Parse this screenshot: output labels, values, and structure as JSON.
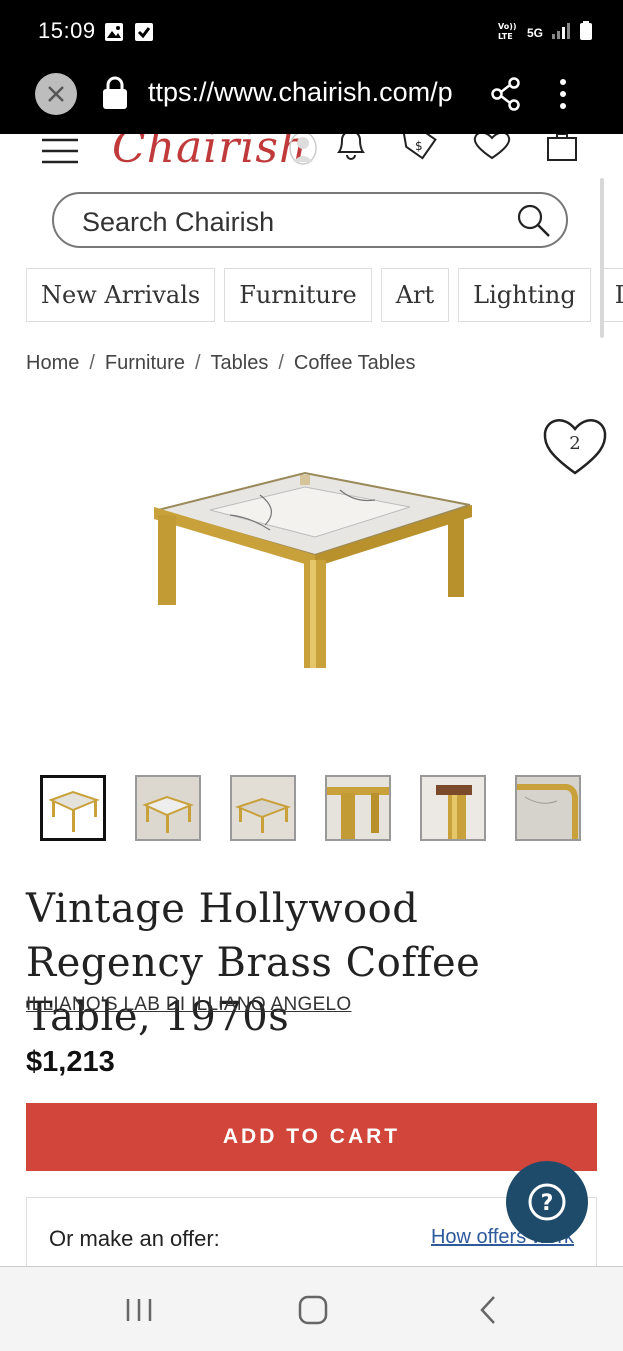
{
  "status_bar": {
    "time": "15:09",
    "network": "5G"
  },
  "browser": {
    "url": "ttps://www.chairish.com/p"
  },
  "site": {
    "logo": "Chairish",
    "search_placeholder": "Search Chairish",
    "categories": [
      "New Arrivals",
      "Furniture",
      "Art",
      "Lighting",
      "Dec"
    ],
    "breadcrumbs": [
      "Home",
      "Furniture",
      "Tables",
      "Coffee Tables"
    ],
    "breadcrumb_separator": "/"
  },
  "product": {
    "favorite_count": "2",
    "title": "Vintage Hollywood Regency Brass Coffee Table, 1970s",
    "maker": "ILLIANO'S LAB DI ILLIANO ANGELO",
    "price": "$1,213",
    "add_to_cart": "ADD TO CART",
    "offer_label": "Or make an offer:",
    "offer_link": "How offers work",
    "thumbnail_count": 6
  },
  "colors": {
    "brand_red": "#d2453a",
    "logo_red": "#c0393b",
    "help_blue": "#1f4b6b",
    "brass": "#c9a13a"
  }
}
